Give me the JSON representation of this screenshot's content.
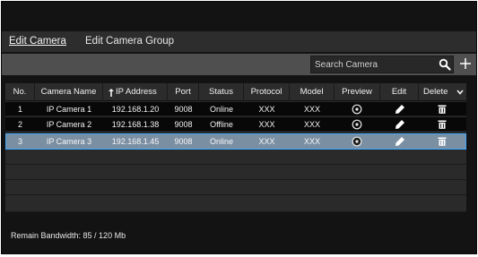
{
  "tabs": [
    {
      "label": "Edit Camera"
    },
    {
      "label": "Edit Camera Group"
    }
  ],
  "search": {
    "placeholder": "Search Camera",
    "value": ""
  },
  "table": {
    "columns": [
      "No.",
      "Camera Name",
      "IP Address",
      "Port",
      "Status",
      "Protocol",
      "Model",
      "Preview",
      "Edit",
      "Delete"
    ],
    "sort_icon": "up-arrow-icon",
    "rows": [
      {
        "no": "1",
        "name": "IP Camera 1",
        "ip": "192.168.1.20",
        "port": "9008",
        "status": "Online",
        "protocol": "XXX",
        "model": "XXX"
      },
      {
        "no": "2",
        "name": "IP Camera 2",
        "ip": "192.168.1.38",
        "port": "9008",
        "status": "Offline",
        "protocol": "XXX",
        "model": "XXX"
      },
      {
        "no": "3",
        "name": "IP Camera 3",
        "ip": "192.168.1.45",
        "port": "9008",
        "status": "Online",
        "protocol": "XXX",
        "model": "XXX"
      }
    ],
    "selected_row": 3
  },
  "footer": {
    "bandwidth": "Remain Bandwidth: 85 / 120 Mb"
  },
  "colors": {
    "background": "#131313",
    "selected_row": "#7b8fa3",
    "selected_border": "#3da9ff"
  }
}
